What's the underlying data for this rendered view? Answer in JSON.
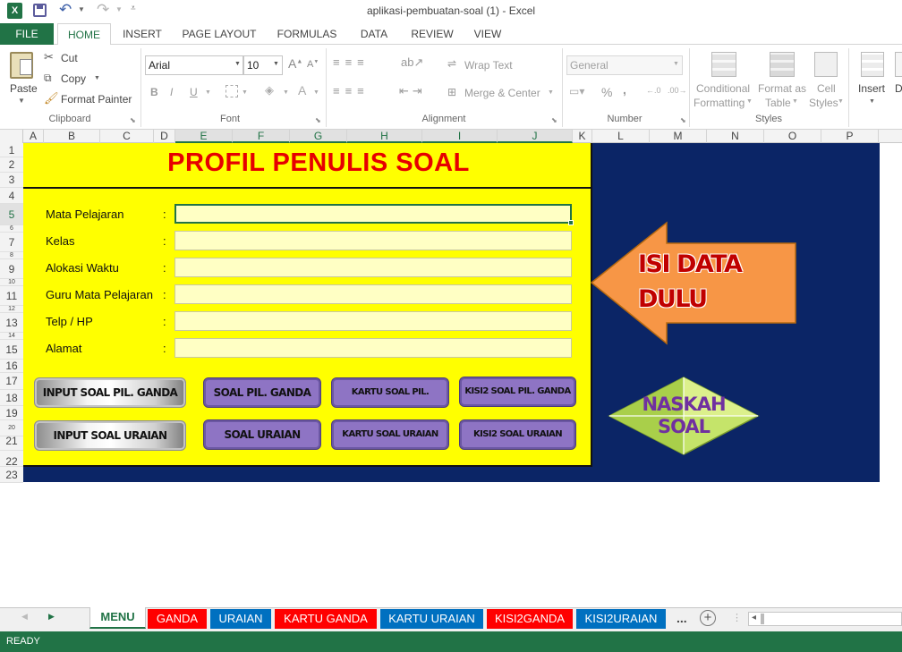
{
  "app": {
    "title": "aplikasi-pembuatan-soal (1) - Excel",
    "status": "READY"
  },
  "ribbon": {
    "tabs": [
      "FILE",
      "HOME",
      "INSERT",
      "PAGE LAYOUT",
      "FORMULAS",
      "DATA",
      "REVIEW",
      "VIEW"
    ],
    "clipboard": {
      "paste": "Paste",
      "cut": "Cut",
      "copy": "Copy",
      "format_painter": "Format Painter",
      "group": "Clipboard"
    },
    "font": {
      "name": "Arial",
      "size": "10",
      "bold": "B",
      "italic": "I",
      "underline": "U",
      "group": "Font"
    },
    "alignment": {
      "wrap": "Wrap Text",
      "merge": "Merge & Center",
      "group": "Alignment"
    },
    "number": {
      "format": "General",
      "percent": "%",
      "comma": ",",
      "group": "Number"
    },
    "styles": {
      "conditional": "Conditional",
      "conditional2": "Formatting",
      "format_as": "Format as",
      "format_as2": "Table",
      "cell": "Cell",
      "cell2": "Styles",
      "group": "Styles"
    },
    "cells": {
      "insert": "Insert",
      "delete": "D"
    }
  },
  "columns": [
    "A",
    "B",
    "C",
    "D",
    "E",
    "F",
    "G",
    "H",
    "I",
    "J",
    "K",
    "L",
    "M",
    "N",
    "O",
    "P"
  ],
  "rows": [
    "1",
    "2",
    "3",
    "4",
    "5",
    "6",
    "7",
    "8",
    "9",
    "10",
    "11",
    "12",
    "13",
    "14",
    "15",
    "16",
    "17",
    "18",
    "19",
    "20",
    "21",
    "22",
    "23"
  ],
  "sheet": {
    "title": "PROFIL PENULIS SOAL",
    "fields": [
      {
        "label": "Mata Pelajaran",
        "colon": ":",
        "value": ""
      },
      {
        "label": "Kelas",
        "colon": ":",
        "value": ""
      },
      {
        "label": "Alokasi Waktu",
        "colon": ":",
        "value": ""
      },
      {
        "label": "Guru Mata Pelajaran",
        "colon": ":",
        "value": ""
      },
      {
        "label": "Telp / HP",
        "colon": ":",
        "value": ""
      },
      {
        "label": "Alamat",
        "colon": ":",
        "value": ""
      }
    ],
    "buttons": {
      "input_pg": "INPUT SOAL PIL. GANDA",
      "soal_pg": "SOAL PIL. GANDA",
      "kartu_pg": "KARTU SOAL PIL.",
      "kisi_pg": "KISI2 SOAL PIL. GANDA",
      "input_uraian": "INPUT SOAL URAIAN",
      "soal_uraian": "SOAL URAIAN",
      "kartu_uraian": "KARTU SOAL URAIAN",
      "kisi_uraian": "KISI2 SOAL URAIAN"
    },
    "arrow_text_1": "ISI DATA",
    "arrow_text_2": "DULU",
    "naskah_1": "NASKAH",
    "naskah_2": "SOAL"
  },
  "sheet_tabs": [
    {
      "label": "MENU",
      "color": "#ffffff"
    },
    {
      "label": "GANDA",
      "color": "#ff0000"
    },
    {
      "label": "URAIAN",
      "color": "#0070c0"
    },
    {
      "label": "KARTU GANDA",
      "color": "#ff0000"
    },
    {
      "label": "KARTU URAIAN",
      "color": "#0070c0"
    },
    {
      "label": "KISI2GANDA",
      "color": "#ff0000"
    },
    {
      "label": "KISI2URAIAN",
      "color": "#0070c0"
    }
  ],
  "more_tabs": "...",
  "colors": {
    "excel_green": "#217346",
    "navy": "#0b2566",
    "title_red": "#e60000",
    "arrow_orange": "#f79646",
    "diamond_green": "#c5e46a"
  }
}
